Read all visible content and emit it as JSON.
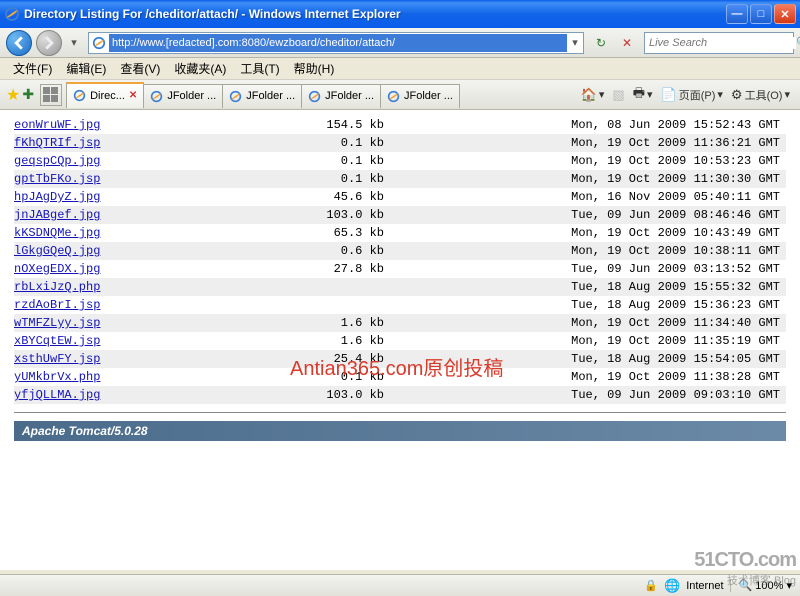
{
  "titlebar": {
    "text": "Directory Listing For /cheditor/attach/ - Windows Internet Explorer"
  },
  "addressbar": {
    "url": "http://www.[redacted].com:8080/ewzboard/cheditor/attach/"
  },
  "searchbox": {
    "placeholder": "Live Search"
  },
  "menu": {
    "file": "文件(F)",
    "edit": "编辑(E)",
    "view": "查看(V)",
    "favorites": "收藏夹(A)",
    "tools": "工具(T)",
    "help": "帮助(H)"
  },
  "tabs": [
    {
      "label": "Direc..."
    },
    {
      "label": "JFolder ..."
    },
    {
      "label": "JFolder ..."
    },
    {
      "label": "JFolder ..."
    },
    {
      "label": "JFolder ..."
    }
  ],
  "toolright": {
    "home": "",
    "print": "",
    "page": "页面(P)",
    "tools": "工具(O)"
  },
  "files": [
    {
      "name": "eonWruWF.jpg",
      "size": "154.5 kb",
      "date": "Mon, 08 Jun 2009 15:52:43 GMT"
    },
    {
      "name": "fKhQTRIf.jsp",
      "size": "0.1 kb",
      "date": "Mon, 19 Oct 2009 11:36:21 GMT"
    },
    {
      "name": "geqspCQp.jpg",
      "size": "0.1 kb",
      "date": "Mon, 19 Oct 2009 10:53:23 GMT"
    },
    {
      "name": "gptTbFKo.jsp",
      "size": "0.1 kb",
      "date": "Mon, 19 Oct 2009 11:30:30 GMT"
    },
    {
      "name": "hpJAgDyZ.jpg",
      "size": "45.6 kb",
      "date": "Mon, 16 Nov 2009 05:40:11 GMT"
    },
    {
      "name": "jnJABgef.jpg",
      "size": "103.0 kb",
      "date": "Tue, 09 Jun 2009 08:46:46 GMT"
    },
    {
      "name": "kKSDNQMe.jpg",
      "size": "65.3 kb",
      "date": "Mon, 19 Oct 2009 10:43:49 GMT"
    },
    {
      "name": "lGkgGQeQ.jpg",
      "size": "0.6 kb",
      "date": "Mon, 19 Oct 2009 10:38:11 GMT"
    },
    {
      "name": "nOXegEDX.jpg",
      "size": "27.8 kb",
      "date": "Tue, 09 Jun 2009 03:13:52 GMT"
    },
    {
      "name": "rbLxiJzQ.php",
      "size": "",
      "date": "Tue, 18 Aug 2009 15:55:32 GMT"
    },
    {
      "name": "rzdAoBrI.jsp",
      "size": "",
      "date": "Tue, 18 Aug 2009 15:36:23 GMT"
    },
    {
      "name": "wTMFZLyy.jsp",
      "size": "1.6 kb",
      "date": "Mon, 19 Oct 2009 11:34:40 GMT"
    },
    {
      "name": "xBYCqtEW.jsp",
      "size": "1.6 kb",
      "date": "Mon, 19 Oct 2009 11:35:19 GMT"
    },
    {
      "name": "xsthUwFY.jsp",
      "size": "25.4 kb",
      "date": "Tue, 18 Aug 2009 15:54:05 GMT"
    },
    {
      "name": "yUMkbrVx.php",
      "size": "0.1 kb",
      "date": "Mon, 19 Oct 2009 11:38:28 GMT"
    },
    {
      "name": "yfjQLLMA.jpg",
      "size": "103.0 kb",
      "date": "Tue, 09 Jun 2009 09:03:10 GMT"
    }
  ],
  "server": "Apache Tomcat/5.0.28",
  "watermark": "Antian365.com原创投稿",
  "statusbar": {
    "zone": "Internet",
    "zoom": "100%"
  },
  "cornerlogo": {
    "l1": "51CTO.com",
    "l2": "技术博客  Blog"
  }
}
